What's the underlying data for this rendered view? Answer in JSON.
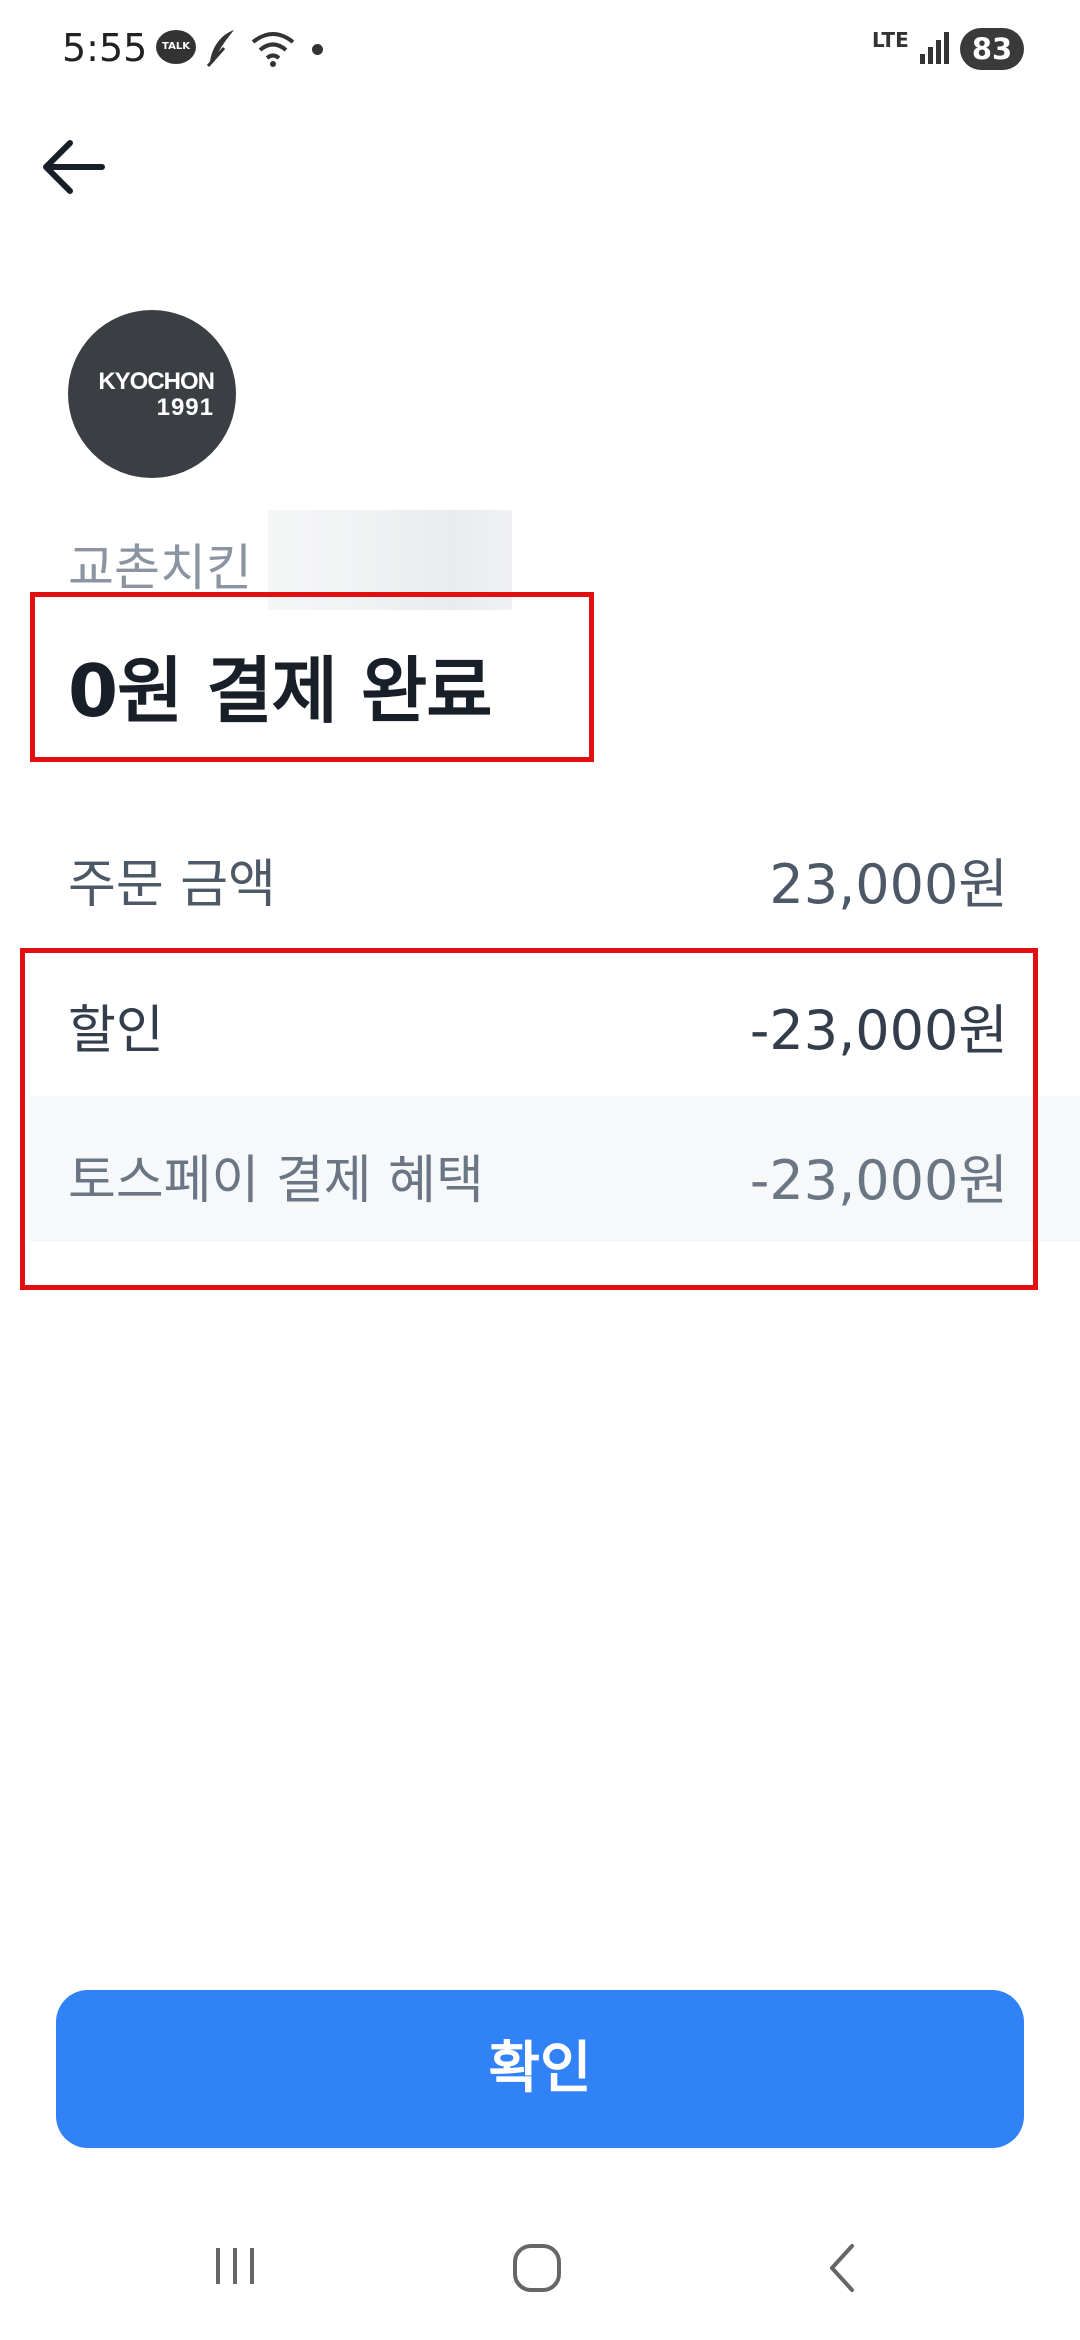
{
  "status_bar": {
    "time": "5:55",
    "talk_label": "TALK",
    "network": "LTE",
    "battery": "83",
    "icons": [
      "talk-icon",
      "feather-icon",
      "wifi-icon",
      "dot-icon",
      "lte-icon",
      "signal-icon",
      "battery-icon"
    ]
  },
  "header": {
    "back_icon": "arrow-left-icon"
  },
  "merchant": {
    "logo_line1": "KYOCHON",
    "logo_line2": "1991",
    "name": "교촌치킨"
  },
  "title": "0원 결제 완료",
  "rows": {
    "order": {
      "label": "주문 금액",
      "value": "23,000원"
    },
    "discount": {
      "label": "할인",
      "value": "-23,000원"
    },
    "benefit": {
      "label": "토스페이 결제 혜택",
      "value": "-23,000원"
    }
  },
  "confirm_button": "확인",
  "nav_bar": {
    "icons": [
      "recent-apps-icon",
      "home-icon",
      "back-nav-icon"
    ]
  },
  "colors": {
    "accent": "#3182f6",
    "highlight": "#e10f0f",
    "title": "#191f28",
    "text_secondary": "#4e5968"
  }
}
